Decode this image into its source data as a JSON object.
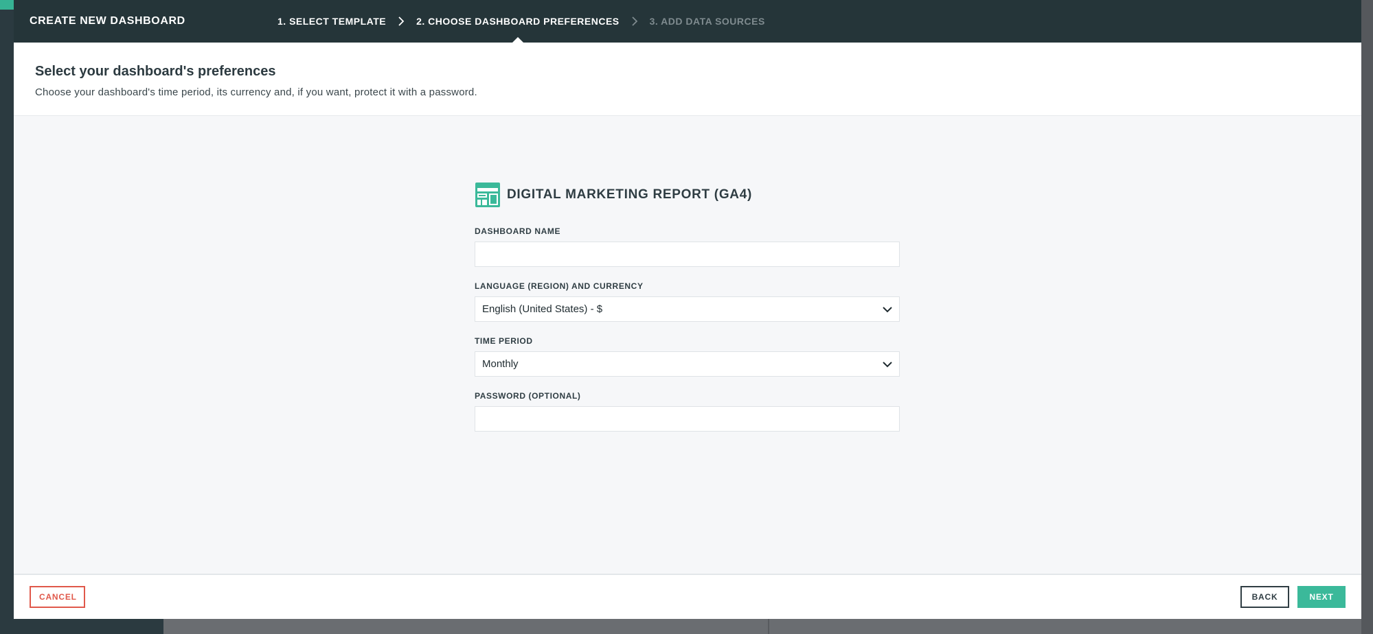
{
  "header": {
    "title": "CREATE NEW DASHBOARD",
    "steps": [
      {
        "label": "1. SELECT TEMPLATE",
        "state": "done"
      },
      {
        "label": "2. CHOOSE DASHBOARD PREFERENCES",
        "state": "active"
      },
      {
        "label": "3. ADD DATA SOURCES",
        "state": "disabled"
      }
    ]
  },
  "intro": {
    "title": "Select your dashboard's preferences",
    "subtitle": "Choose your dashboard's time period, its currency and, if you want, protect it with a password."
  },
  "form": {
    "report_icon": "dashboard-template-icon",
    "report_title": "DIGITAL MARKETING REPORT (GA4)",
    "dashboard_name": {
      "label": "DASHBOARD NAME",
      "value": "",
      "placeholder": ""
    },
    "language_currency": {
      "label": "LANGUAGE (REGION) AND CURRENCY",
      "value": "English (United States) - $"
    },
    "time_period": {
      "label": "TIME PERIOD",
      "value": "Monthly"
    },
    "password": {
      "label": "PASSWORD (OPTIONAL)",
      "value": "",
      "placeholder": ""
    }
  },
  "footer": {
    "cancel_label": "CANCEL",
    "back_label": "BACK",
    "next_label": "NEXT"
  },
  "colors": {
    "header_bg": "#253539",
    "accent": "#3bb99a",
    "danger": "#e0584a",
    "text_dark": "#2f3d43"
  }
}
